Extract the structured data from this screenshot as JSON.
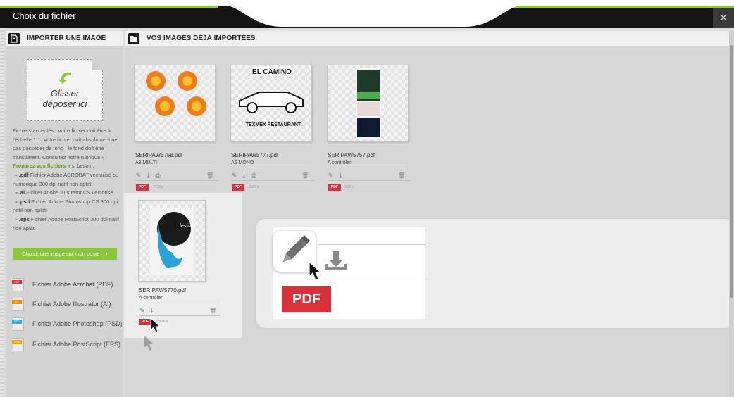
{
  "window": {
    "title": "Choix du fichier",
    "close_glyph": "×"
  },
  "left_panel": {
    "header": "IMPORTER UNE IMAGE",
    "dropzone": {
      "line1": "Glisser",
      "line2": "déposer ici"
    },
    "info": {
      "p1": "Fichiers acceptés : votre fichier doit être à l'échelle 1:1. Votre fichier doit absolument ne pas posséder de fond : le fond doit être transparent. Consultez notre rubrique",
      "link": "« Préparez vos fichiers »",
      "p1_end": "si besoin.",
      "pdf_ext": "- .pdf",
      "pdf_desc": "Fichier Adobe ACROBAT vectorisé ou numérique 300 dpi natif non aplati",
      "ai_ext": "- .ai",
      "ai_desc": "Fichier Adobe Illustrator CS vectorisé",
      "psd_ext": "- .psd",
      "psd_desc": "Fichier Adobe Photoshop CS 300 dpi natif non aplati",
      "eps_ext": "- .eps",
      "eps_desc": "Fichier Adobe PostScript 300 dpi natif non aplati"
    },
    "choose_button": "Choisir une image sur mon poste",
    "choose_chevron": "›",
    "file_types": [
      {
        "label": "Fichier Adobe Acrobat (PDF)",
        "badge": "PDF",
        "color": "#d9303a"
      },
      {
        "label": "Fichier Adobe Illustrator (AI)",
        "badge": "AI",
        "color": "#f29200"
      },
      {
        "label": "Fichier Adobe Photoshop (PSD)",
        "badge": "PSD",
        "color": "#2aa7df"
      },
      {
        "label": "Fichier Adobe PostScript (EPS)",
        "badge": "EPS",
        "color": "#f2a200"
      }
    ]
  },
  "right_panel": {
    "header": "VOS IMAGES DÉJÀ IMPORTÉES",
    "files": [
      {
        "name": "SERIPAW5758.pdf",
        "sub": "A3 MULTI",
        "badge": "PDF",
        "size": "742Ko"
      },
      {
        "name": "SERIPAW5777.pdf",
        "sub": "A6 MONO",
        "badge": "PDF",
        "size": "210Ko",
        "thumb_title": "EL CAMINO",
        "thumb_text": "TEXMEX RESTAURANT"
      },
      {
        "name": "SERIPAW5757.pdf",
        "sub": "A contrôler",
        "badge": "PDF",
        "size": "59Ko"
      },
      {
        "name": "SERIPAW5770.pdf",
        "sub": "A contrôler",
        "badge": "PDF",
        "size": "1398Ko",
        "thumb_text": "festival"
      }
    ]
  },
  "zoom": {
    "badge": "PDF"
  },
  "colors": {
    "accent_green": "#8cc63f",
    "pdf_red": "#d9303a",
    "titlebar": "#141414"
  }
}
